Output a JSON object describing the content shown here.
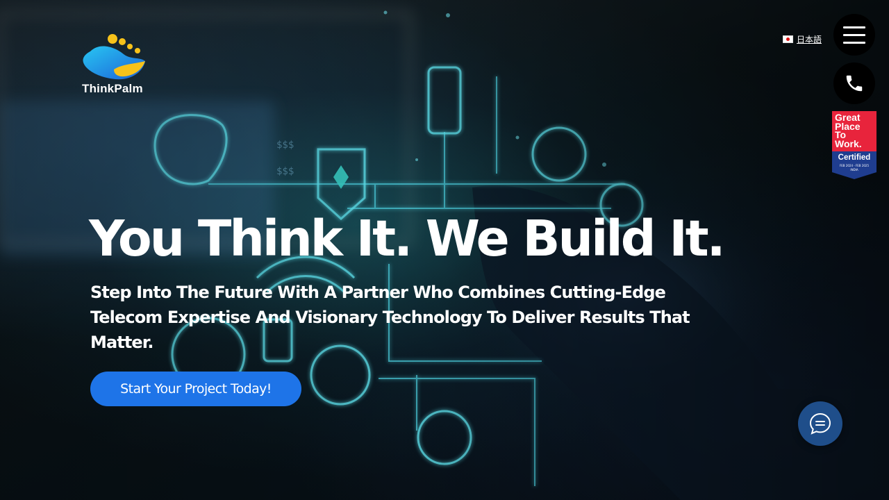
{
  "brand": {
    "name": "ThinkPalm",
    "logo_icon": "thinkpalm-logo"
  },
  "language": {
    "label": "日本語",
    "flag_icon": "japan-flag-icon"
  },
  "menu": {
    "icon": "hamburger-menu-icon"
  },
  "contact": {
    "icon": "phone-icon"
  },
  "badge": {
    "line1": "Great",
    "line2": "Place",
    "line3": "To",
    "line4": "Work.",
    "certified": "Certified",
    "dates": "FEB 2024 - FEB 2025",
    "country": "INDIA",
    "colors": {
      "top": "#e8243c",
      "bottom": "#1f3d8f"
    }
  },
  "hero": {
    "headline": "You Think It. We Build It.",
    "subheadline": "Step Into The Future With A Partner Who Combines Cutting-Edge Telecom Expertise And Visionary Technology To Deliver Results That Matter.",
    "cta_label": "Start Your Project Today!",
    "cta_color": "#1e74e8"
  },
  "chat": {
    "icon": "chat-bubble-icon",
    "color": "#1f4e8a"
  }
}
